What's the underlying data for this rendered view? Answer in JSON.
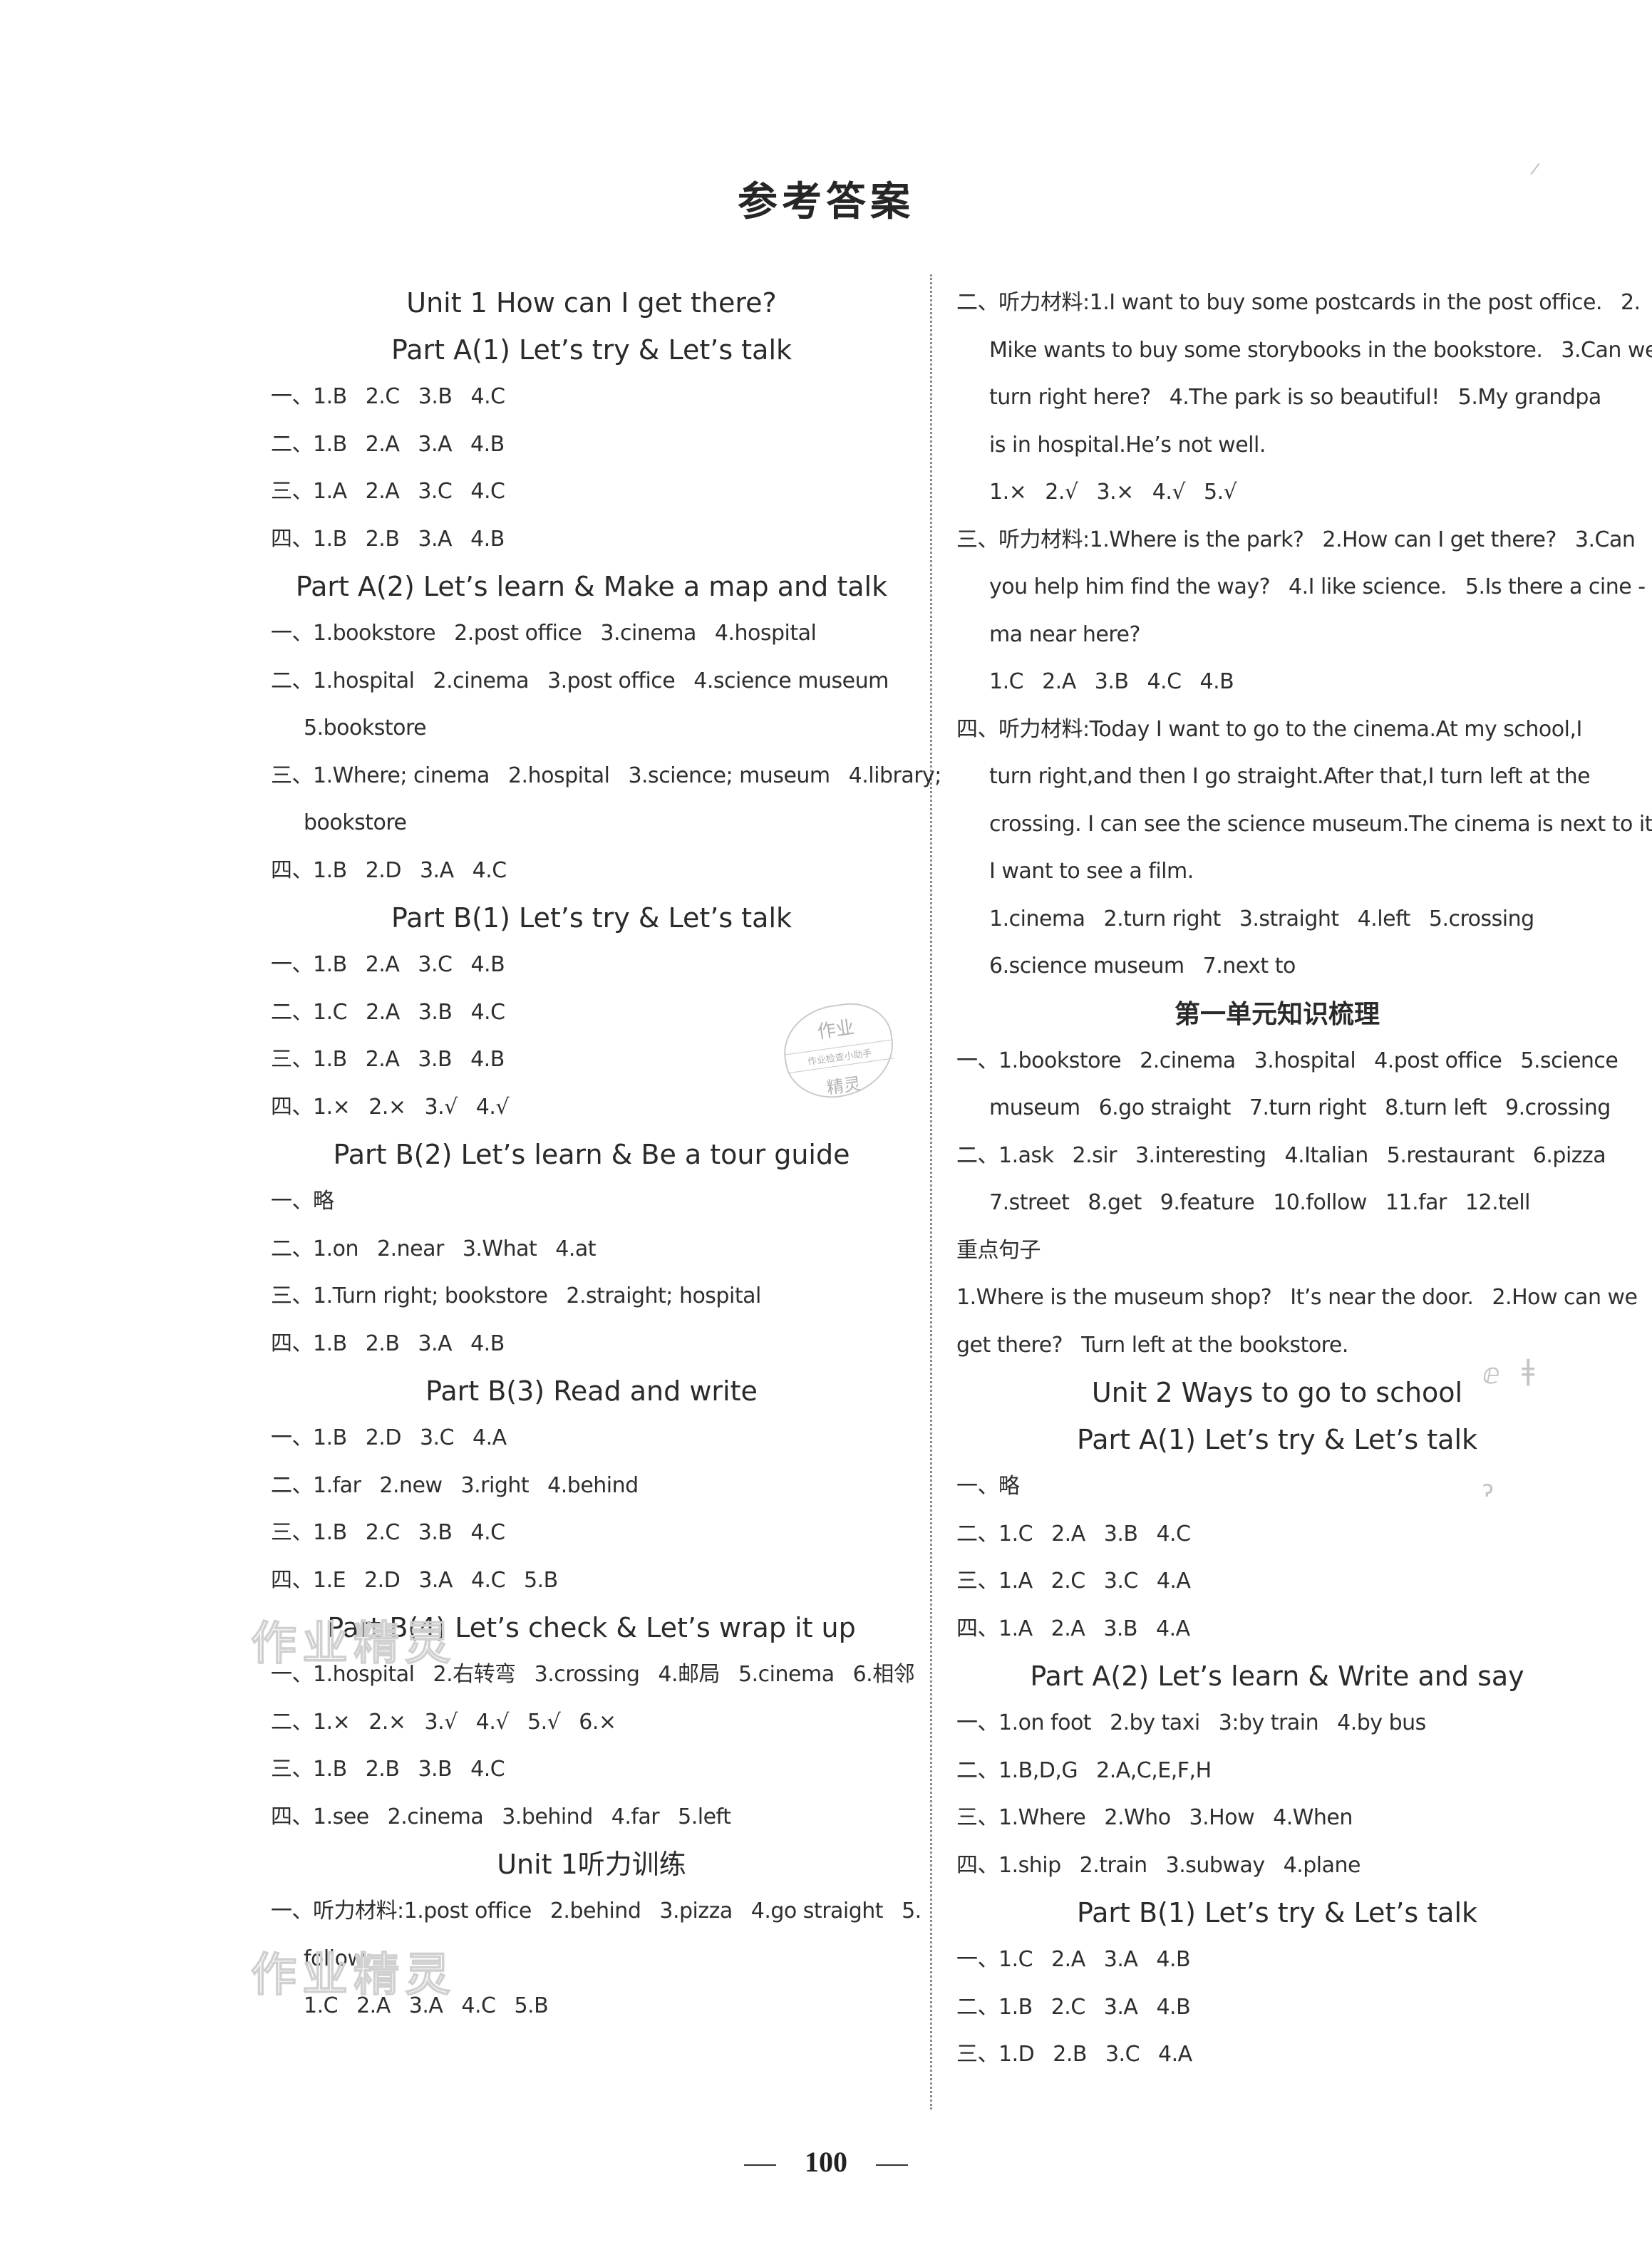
{
  "page_title": "参考答案",
  "page_number": "100",
  "stamp": {
    "top": "作业",
    "middle": "作业检查小助手",
    "bottom": "精灵"
  },
  "watermark": "作业精灵",
  "left_column": {
    "unit1_title": "Unit 1    How can I get there?",
    "a1": {
      "title": "Part A(1) Let’s try & Let’s talk",
      "lines": [
        {
          "label": "一、",
          "answers": [
            "1.B",
            "2.C",
            "3.B",
            "4.C"
          ]
        },
        {
          "label": "二、",
          "answers": [
            "1.B",
            "2.A",
            "3.A",
            "4.B"
          ]
        },
        {
          "label": "三、",
          "answers": [
            "1.A",
            "2.A",
            "3.C",
            "4.C"
          ]
        },
        {
          "label": "四、",
          "answers": [
            "1.B",
            "2.B",
            "3.A",
            "4.B"
          ]
        }
      ]
    },
    "a2": {
      "title": "Part A(2) Let’s learn &  Make a map and talk",
      "lines": [
        {
          "label": "一、",
          "answers": [
            "1.bookstore",
            "2.post office",
            "3.cinema",
            "4.hospital"
          ]
        },
        {
          "label": "二、",
          "answers": [
            "1.hospital",
            "2.cinema",
            "3.post office",
            "4.science museum"
          ]
        },
        {
          "label": "",
          "answers": [
            "5.bookstore"
          ]
        },
        {
          "label": "三、",
          "answers": [
            "1.Where; cinema",
            "2.hospital",
            "3.science; museum",
            "4.library;"
          ]
        },
        {
          "label": "",
          "answers": [
            "bookstore"
          ]
        },
        {
          "label": "四、",
          "answers": [
            "1.B",
            "2.D",
            "3.A",
            "4.C"
          ]
        }
      ]
    },
    "b1": {
      "title": "Part B(1) Let’s try & Let’s talk",
      "lines": [
        {
          "label": "一、",
          "answers": [
            "1.B",
            "2.A",
            "3.C",
            "4.B"
          ]
        },
        {
          "label": "二、",
          "answers": [
            "1.C",
            "2.A",
            "3.B",
            "4.C"
          ]
        },
        {
          "label": "三、",
          "answers": [
            "1.B",
            "2.A",
            "3.B",
            "4.B"
          ]
        },
        {
          "label": "四、",
          "answers": [
            "1.×",
            "2.×",
            "3.√",
            "4.√"
          ]
        }
      ]
    },
    "b2": {
      "title": "Part B(2) Let’s learn &  Be a tour guide",
      "lines": [
        {
          "label": "一、",
          "answers": [
            "略"
          ]
        },
        {
          "label": "二、",
          "answers": [
            "1.on",
            "2.near",
            "3.What",
            "4.at"
          ]
        },
        {
          "label": "三、",
          "answers": [
            "1.Turn right; bookstore",
            "2.straight; hospital"
          ]
        },
        {
          "label": "四、",
          "answers": [
            "1.B",
            "2.B",
            "3.A",
            "4.B"
          ]
        }
      ]
    },
    "b3": {
      "title": "Part B(3) Read and write",
      "lines": [
        {
          "label": "一、",
          "answers": [
            "1.B",
            "2.D",
            "3.C",
            "4.A"
          ]
        },
        {
          "label": "二、",
          "answers": [
            "1.far",
            "2.new",
            "3.right",
            "4.behind"
          ]
        },
        {
          "label": "三、",
          "answers": [
            "1.B",
            "2.C",
            "3.B",
            "4.C"
          ]
        },
        {
          "label": "四、",
          "answers": [
            "1.E",
            "2.D",
            "3.A",
            "4.C",
            "5.B"
          ]
        }
      ]
    },
    "b4": {
      "title": "Part B(4) Let’s check &  Let’s wrap it up",
      "lines": [
        {
          "label": "一、",
          "answers": [
            "1.hospital",
            "2.右转弯",
            "3.crossing",
            "4.邮局",
            "5.cinema",
            "6.相邻"
          ]
        },
        {
          "label": "二、",
          "answers": [
            "1.×",
            "2.×",
            "3.√",
            "4.√",
            "5.√",
            "6.×"
          ]
        },
        {
          "label": "三、",
          "answers": [
            "1.B",
            "2.B",
            "3.B",
            "4.C"
          ]
        },
        {
          "label": "四、",
          "answers": [
            "1.see",
            "2.cinema",
            "3.behind",
            "4.far",
            "5.left"
          ]
        }
      ]
    },
    "listening": {
      "title": "Unit 1听力训练",
      "lines": [
        {
          "label": "一、听力材料:",
          "answers": [
            "1.post office",
            "2.behind",
            "3.pizza",
            "4.go straight",
            "5."
          ]
        },
        {
          "label": "",
          "answers": [
            "follow"
          ]
        },
        {
          "label": "",
          "answers": [
            "1.C",
            "2.A",
            "3.A",
            "4.C",
            "5.B"
          ]
        }
      ]
    }
  },
  "right_column": {
    "listening_cont": {
      "lines": [
        {
          "label": "二、听力材料:",
          "answers": [
            "1.I want to buy some postcards in the post office.",
            "2."
          ]
        },
        {
          "label": "",
          "answers": [
            "Mike wants to buy some storybooks in the bookstore.",
            "3.Can we"
          ]
        },
        {
          "label": "",
          "answers": [
            "turn right here?",
            "4.The park is so beautiful!",
            "5.My grandpa"
          ]
        },
        {
          "label": "",
          "answers": [
            "is in hospital.He’s not well."
          ]
        },
        {
          "label": "",
          "answers": [
            "1.×",
            "2.√",
            "3.×",
            "4.√",
            "5.√"
          ]
        },
        {
          "label": "三、听力材料:",
          "answers": [
            "1.Where is the park?",
            "2.How can I get there?",
            "3.Can"
          ]
        },
        {
          "label": "",
          "answers": [
            "you help him find the way?",
            "4.I like science.",
            "5.Is there a cine -"
          ]
        },
        {
          "label": "",
          "answers": [
            "ma near here?"
          ]
        },
        {
          "label": "",
          "answers": [
            "1.C",
            "2.A",
            "3.B",
            "4.C",
            "4.B"
          ]
        },
        {
          "label": "四、听力材料:",
          "answers": [
            "Today I want to go to the cinema.At my school,I"
          ]
        },
        {
          "label": "",
          "answers": [
            "turn right,and then I go straight.After that,I turn left at the"
          ]
        },
        {
          "label": "",
          "answers": [
            "crossing. I can see the science museum.The cinema is next to it."
          ]
        },
        {
          "label": "",
          "answers": [
            "I want to see a film."
          ]
        },
        {
          "label": "",
          "answers": [
            "1.cinema",
            "2.turn right",
            "3.straight",
            "4.left",
            "5.crossing"
          ]
        },
        {
          "label": "",
          "answers": [
            "6.science museum",
            "7.next to"
          ]
        }
      ]
    },
    "review": {
      "title": "第一单元知识梳理",
      "lines": [
        {
          "label": "一、",
          "answers": [
            "1.bookstore",
            "2.cinema",
            "3.hospital",
            "4.post office",
            "5.science"
          ]
        },
        {
          "label": "",
          "answers": [
            "museum",
            "6.go straight",
            "7.turn right",
            "8.turn left",
            "9.crossing"
          ]
        },
        {
          "label": "二、",
          "answers": [
            "1.ask",
            "2.sir",
            "3.interesting",
            "4.Italian",
            "5.restaurant",
            "6.pizza"
          ]
        },
        {
          "label": "",
          "answers": [
            "7.street",
            "8.get",
            "9.feature",
            "10.follow",
            "11.far",
            "12.tell"
          ]
        }
      ],
      "key_sentences_label": "重点句子",
      "key_sentences": [
        {
          "label": "",
          "answers": [
            "1.Where is the museum shop?",
            "It’s near the door.",
            "2.How can we"
          ]
        },
        {
          "label": "",
          "answers": [
            "get there?",
            "Turn left at the bookstore."
          ]
        }
      ]
    },
    "unit2_title": "Unit 2    Ways to go to school",
    "u2a1": {
      "title": "Part A(1) Let’s try & Let’s talk",
      "lines": [
        {
          "label": "一、",
          "answers": [
            "略"
          ]
        },
        {
          "label": "二、",
          "answers": [
            "1.C",
            "2.A",
            "3.B",
            "4.C"
          ]
        },
        {
          "label": "三、",
          "answers": [
            "1.A",
            "2.C",
            "3.C",
            "4.A"
          ]
        },
        {
          "label": "四、",
          "answers": [
            "1.A",
            "2.A",
            "3.B",
            "4.A"
          ]
        }
      ]
    },
    "u2a2": {
      "title": "Part A(2) Let’s learn &  Write and say",
      "lines": [
        {
          "label": "一、",
          "answers": [
            "1.on foot",
            "2.by taxi",
            "3:by train",
            "4.by bus"
          ]
        },
        {
          "label": "二、",
          "answers": [
            "1.B,D,G",
            "2.A,C,E,F,H"
          ]
        },
        {
          "label": "三、",
          "answers": [
            "1.Where",
            "2.Who",
            "3.How",
            "4.When"
          ]
        },
        {
          "label": "四、",
          "answers": [
            "1.ship",
            "2.train",
            "3.subway",
            "4.plane"
          ]
        }
      ]
    },
    "u2b1": {
      "title": "Part B(1)   Let’s try & Let’s talk",
      "lines": [
        {
          "label": "一、",
          "answers": [
            "1.C",
            "2.A",
            "3.A",
            "4.B"
          ]
        },
        {
          "label": "二、",
          "answers": [
            "1.B",
            "2.C",
            "3.A",
            "4.B"
          ]
        },
        {
          "label": "三、",
          "answers": [
            "1.D",
            "2.B",
            "3.C",
            "4.A"
          ]
        }
      ]
    }
  }
}
